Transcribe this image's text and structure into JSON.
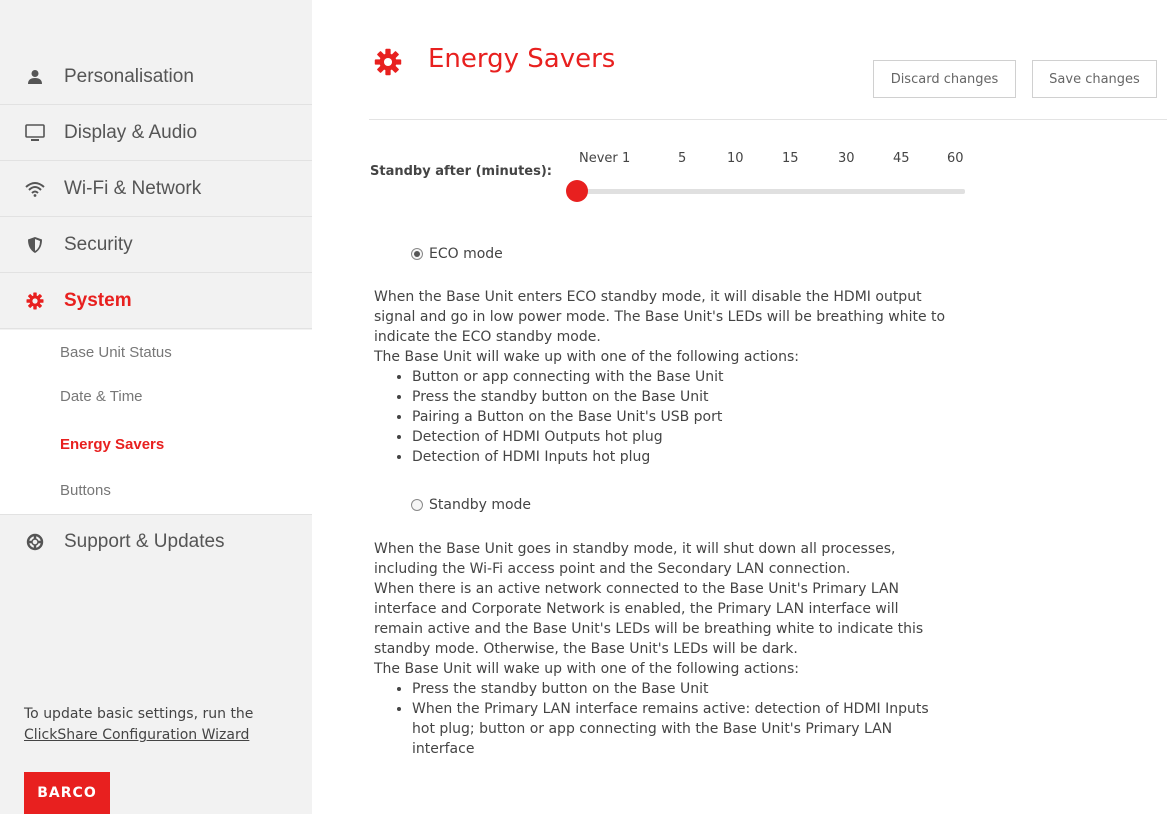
{
  "sidebar": {
    "items": [
      {
        "label": "Personalisation",
        "icon": "user-icon"
      },
      {
        "label": "Display & Audio",
        "icon": "monitor-icon"
      },
      {
        "label": "Wi-Fi & Network",
        "icon": "wifi-icon"
      },
      {
        "label": "Security",
        "icon": "shield-icon"
      },
      {
        "label": "System",
        "icon": "gear-icon"
      },
      {
        "label": "Support & Updates",
        "icon": "lifebuoy-icon"
      }
    ],
    "submenu": [
      "Base Unit Status",
      "Date & Time",
      "Energy Savers",
      "Buttons"
    ],
    "active_item": "System",
    "active_subitem": "Energy Savers",
    "hint_text": "To update basic settings, run the",
    "hint_link": "ClickShare Configuration Wizard",
    "logo_text": "BARCO"
  },
  "header": {
    "title": "Energy Savers",
    "discard_label": "Discard changes",
    "save_label": "Save changes"
  },
  "standby": {
    "label": "Standby after (minutes):",
    "ticks": [
      "Never",
      "1",
      "5",
      "10",
      "15",
      "30",
      "45",
      "60"
    ],
    "selected": "Never"
  },
  "modes": {
    "eco": {
      "label": "ECO mode",
      "selected": true,
      "description": [
        "When the Base Unit enters ECO standby mode, it will disable the HDMI output",
        "signal and go in low power mode. The Base Unit's LEDs will be breathing white to",
        "indicate the ECO standby mode.",
        "The Base Unit will wake up with one of the following actions:"
      ],
      "actions": [
        "Button or app connecting with the Base Unit",
        "Press the standby button on the Base Unit",
        "Pairing a Button on the Base Unit's USB port",
        "Detection of HDMI Outputs hot plug",
        "Detection of HDMI Inputs hot plug"
      ]
    },
    "standby": {
      "label": "Standby mode",
      "selected": false,
      "description": [
        "When the Base Unit goes in standby mode, it will shut down all processes,",
        "including the Wi-Fi access point and the Secondary LAN connection.",
        "When there is an active network connected to the Base Unit's Primary LAN",
        "interface and Corporate Network is enabled, the Primary LAN interface will",
        "remain active and the Base Unit's LEDs will be breathing white to indicate this",
        "standby mode. Otherwise, the Base Unit's LEDs will be dark.",
        "The Base Unit will wake up with one of the following actions:"
      ],
      "actions": [
        "Press the standby button on the Base Unit",
        "When the Primary LAN interface remains active: detection of HDMI Inputs hot plug; button or app connecting with the Base Unit's Primary LAN interface"
      ]
    }
  },
  "colors": {
    "accent": "#e8201f",
    "sidebar_bg": "#f2f2f2"
  }
}
